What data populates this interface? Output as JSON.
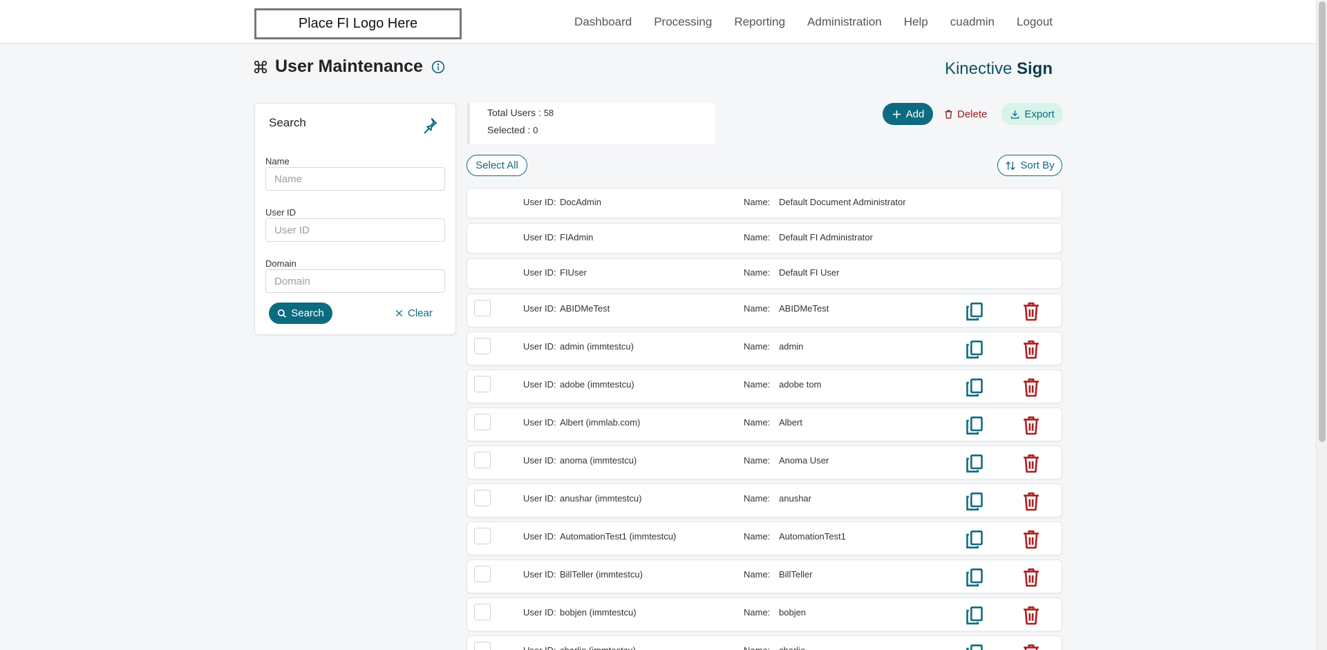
{
  "header": {
    "logo_text": "Place FI Logo Here",
    "nav": [
      "Dashboard",
      "Processing",
      "Reporting",
      "Administration",
      "Help",
      "cuadmin",
      "Logout"
    ]
  },
  "page": {
    "title": "User Maintenance",
    "brand_light": "Kinective",
    "brand_bold": "Sign"
  },
  "search": {
    "title": "Search",
    "name_label": "Name",
    "name_placeholder": "Name",
    "userid_label": "User ID",
    "userid_placeholder": "User ID",
    "domain_label": "Domain",
    "domain_placeholder": "Domain",
    "search_button": "Search",
    "clear_button": "Clear"
  },
  "summary": {
    "total_label": "Total Users :",
    "total_value": "58",
    "selected_label": "Selected :",
    "selected_value": "0"
  },
  "actions": {
    "add": "Add",
    "delete": "Delete",
    "export": "Export",
    "select_all": "Select All",
    "sort_by": "Sort By"
  },
  "list_labels": {
    "user_id": "User ID:",
    "name": "Name:"
  },
  "colors": {
    "primary": "#0d6b7f",
    "danger": "#9b1b1b",
    "export_bg": "#d8f3ea"
  },
  "system_users": [
    {
      "user_id": "DocAdmin",
      "name": "Default Document Administrator"
    },
    {
      "user_id": "FIAdmin",
      "name": "Default FI Administrator"
    },
    {
      "user_id": "FIUser",
      "name": "Default FI User"
    }
  ],
  "users": [
    {
      "user_id": "ABIDMeTest",
      "name": "ABIDMeTest"
    },
    {
      "user_id": "admin (immtestcu)",
      "name": "admin"
    },
    {
      "user_id": "adobe (immtestcu)",
      "name": "adobe tom"
    },
    {
      "user_id": "Albert (immlab.com)",
      "name": "Albert"
    },
    {
      "user_id": "anoma (immtestcu)",
      "name": "Anoma User"
    },
    {
      "user_id": "anushar (immtestcu)",
      "name": "anushar"
    },
    {
      "user_id": "AutomationTest1 (immtestcu)",
      "name": "AutomationTest1"
    },
    {
      "user_id": "BillTeller (immtestcu)",
      "name": "BillTeller"
    },
    {
      "user_id": "bobjen (immtestcu)",
      "name": "bobjen"
    },
    {
      "user_id": "charlie (immtestcu)",
      "name": "charlie"
    }
  ]
}
